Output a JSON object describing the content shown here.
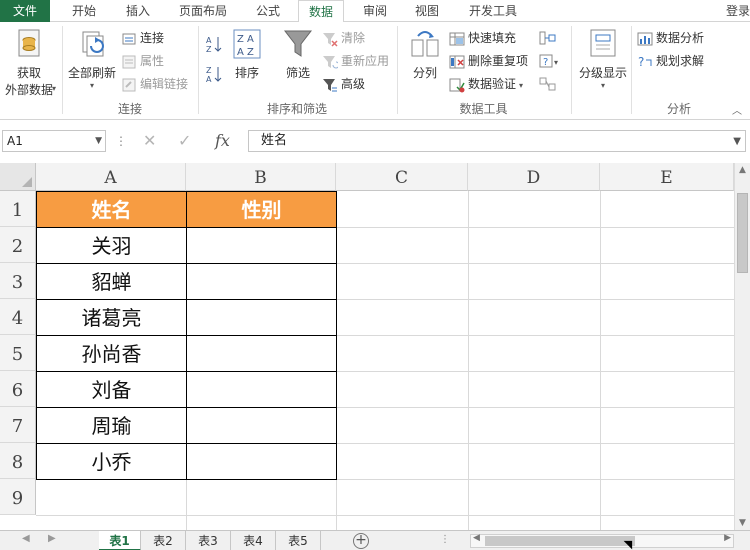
{
  "ribbon_tabs": {
    "file": "文件",
    "home": "开始",
    "insert": "插入",
    "page_layout": "页面布局",
    "formulas": "公式",
    "data": "数据",
    "review": "审阅",
    "view": "视图",
    "developer": "开发工具",
    "login": "登录"
  },
  "ribbon": {
    "get_external_line1": "获取",
    "get_external_line2": "外部数据",
    "refresh_all": "全部刷新",
    "connections": "连接",
    "properties": "属性",
    "edit_links": "编辑链接",
    "group_connections": "连接",
    "sort": "排序",
    "filter": "筛选",
    "clear": "清除",
    "reapply": "重新应用",
    "advanced": "高级",
    "group_sort_filter": "排序和筛选",
    "text_to_columns": "分列",
    "flash_fill": "快速填充",
    "remove_duplicates": "删除重复项",
    "data_validation": "数据验证",
    "group_data_tools": "数据工具",
    "outline": "分级显示",
    "data_analysis": "数据分析",
    "solver": "规划求解",
    "group_analysis": "分析"
  },
  "formula_bar": {
    "name_box": "A1",
    "formula_value": "姓名",
    "fx": "fx"
  },
  "columns": [
    "A",
    "B",
    "C",
    "D",
    "E"
  ],
  "rows": [
    "1",
    "2",
    "3",
    "4",
    "5",
    "6",
    "7",
    "8",
    "9"
  ],
  "table": {
    "header_name": "姓名",
    "header_gender": "性别",
    "names": [
      "关羽",
      "貂蝉",
      "诸葛亮",
      "孙尚香",
      "刘备",
      "周瑜",
      "小乔"
    ],
    "header_fill": "#f79c42"
  },
  "sheets": [
    "表1",
    "表2",
    "表3",
    "表4",
    "表5"
  ],
  "active_sheet": "表1",
  "accent": "#217346"
}
